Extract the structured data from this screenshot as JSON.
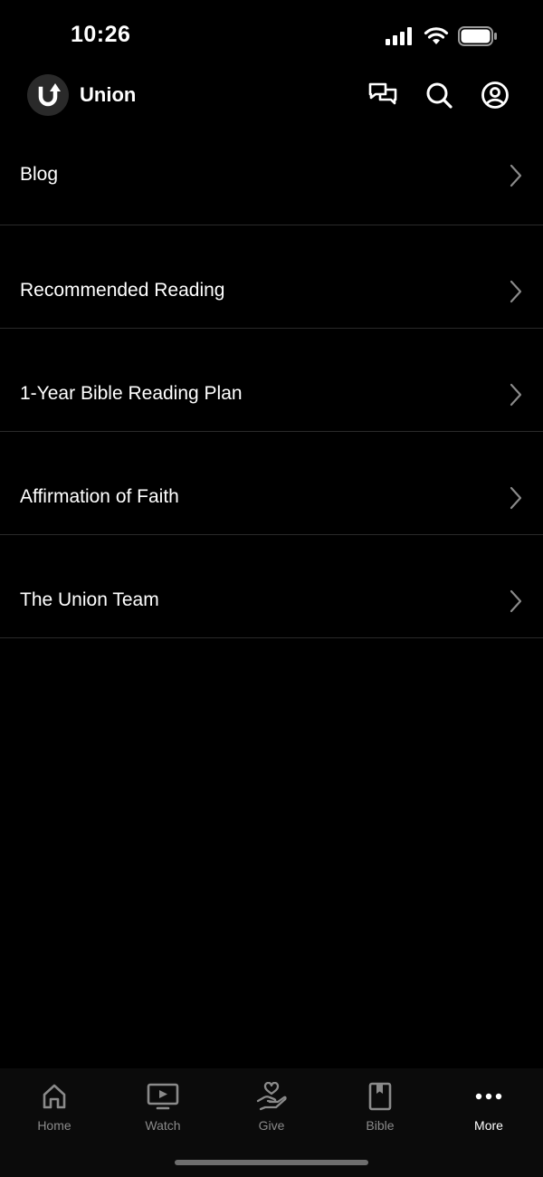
{
  "status_bar": {
    "time": "10:26"
  },
  "header": {
    "app_name": "Union"
  },
  "menu": {
    "items": [
      {
        "label": "Blog"
      },
      {
        "label": "Recommended Reading"
      },
      {
        "label": "1-Year Bible Reading Plan"
      },
      {
        "label": "Affirmation of Faith"
      },
      {
        "label": "The Union Team"
      }
    ]
  },
  "tab_bar": {
    "tabs": [
      {
        "label": "Home",
        "icon": "home-icon"
      },
      {
        "label": "Watch",
        "icon": "tv-icon"
      },
      {
        "label": "Give",
        "icon": "hand-heart-icon"
      },
      {
        "label": "Bible",
        "icon": "book-icon"
      },
      {
        "label": "More",
        "icon": "more-icon",
        "active": true
      }
    ]
  },
  "colors": {
    "background": "#000000",
    "divider": "#2a2a2a",
    "inactive_tab": "#8a8a8a",
    "active_tab": "#ffffff"
  }
}
